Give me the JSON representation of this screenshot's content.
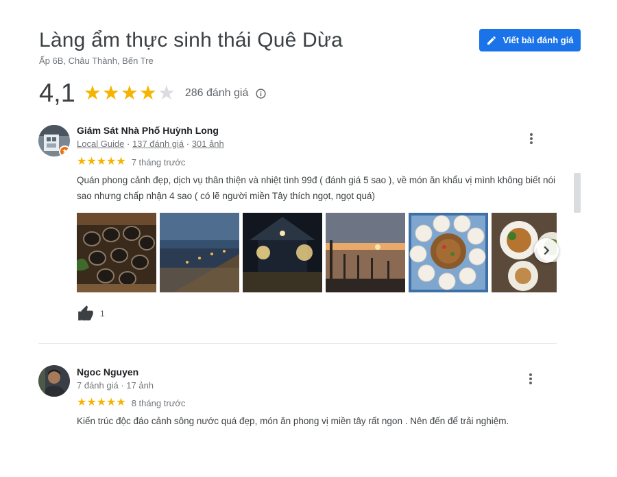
{
  "place": {
    "title": "Làng ẩm thực sinh thái Quê Dừa",
    "address": "Ấp 6B, Châu Thành, Bến Tre",
    "rating": "4,1",
    "stars_filled": 4,
    "stars_total": 5,
    "review_count": "286 đánh giá",
    "write_review_label": "Viết bài đánh giá"
  },
  "reviews": [
    {
      "name": "Giám Sát Nhà Phố Huỳnh Long",
      "guide": "Local Guide",
      "sep": " · ",
      "review_count": "137 đánh giá",
      "photo_count": "301 ảnh",
      "stars": 5,
      "when": "7 tháng trước",
      "text": "Quán phong cảnh đẹp, dịch vụ thân thiện và nhiệt tình 99đ ( đánh giá 5 sao ), về món ăn khẩu vị mình không biết nói sao nhưng chấp nhận 4 sao ( có lẽ người miền Tây thích ngọt, ngọt quá)",
      "likes": "1"
    },
    {
      "name": "Ngoc Nguyen",
      "meta": "7 đánh giá · 17 ảnh",
      "stars": 5,
      "when": "8 tháng trước",
      "text": "Kiến trúc độc đáo cảnh sông nước quá đẹp, món ăn phong vị miền tây rất ngon       . Nên đến để trải nghiệm."
    }
  ],
  "icons": {
    "star": "★",
    "edit": "pencil-icon",
    "info": "info-icon",
    "like": "thumbs-up-icon",
    "more": "more-vert-icon",
    "next": "chevron-right-icon"
  },
  "colors": {
    "accent": "#1a73e8",
    "star": "#f4b400",
    "star_empty": "#dadce0",
    "guide_badge": "#e8710a"
  }
}
